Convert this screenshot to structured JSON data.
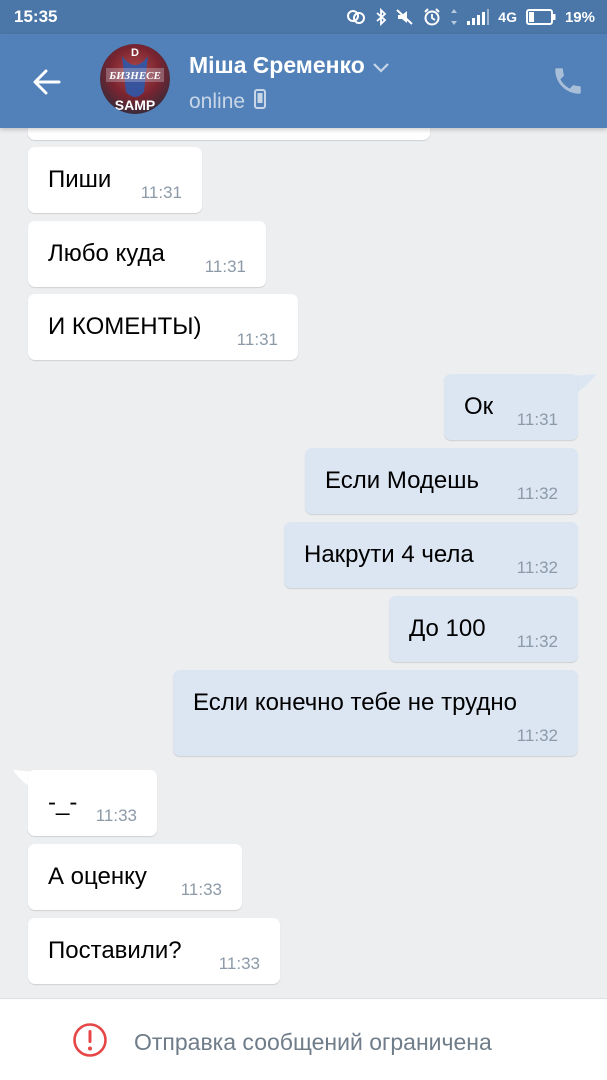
{
  "status_bar": {
    "time": "15:35",
    "network": "4G",
    "battery_percent": "19%",
    "icons": [
      "link-icon",
      "bluetooth-icon",
      "mute-icon",
      "alarm-icon",
      "data-arrows-icon",
      "signal-icon",
      "battery-icon"
    ]
  },
  "header": {
    "contact_name": "Міша Єременко",
    "status": "online",
    "avatar_text": {
      "top": "D",
      "middle": "БИЗНЕСЕ",
      "bottom": "SAMP"
    },
    "icons": [
      "back-arrow-icon",
      "chevron-down-icon",
      "mobile-phone-icon",
      "phone-call-icon"
    ]
  },
  "messages": [
    {
      "direction": "in",
      "text": "Пиши",
      "time": "11:31"
    },
    {
      "direction": "in",
      "text": "Любо куда",
      "time": "11:31"
    },
    {
      "direction": "in",
      "text": "И КОМЕНТЫ)",
      "time": "11:31"
    },
    {
      "direction": "out",
      "text": "Ок",
      "time": "11:31"
    },
    {
      "direction": "out",
      "text": "Если Модешь",
      "time": "11:32"
    },
    {
      "direction": "out",
      "text": "Накрути 4 чела",
      "time": "11:32"
    },
    {
      "direction": "out",
      "text": "До 100",
      "time": "11:32"
    },
    {
      "direction": "out",
      "text": "Если конечно тебе не трудно",
      "time": "11:32"
    },
    {
      "direction": "in",
      "text": "-_-",
      "time": "11:33"
    },
    {
      "direction": "in",
      "text": "А оценку",
      "time": "11:33"
    },
    {
      "direction": "in",
      "text": "Поставили?",
      "time": "11:33"
    }
  ],
  "footer": {
    "restriction_text": "Отправка сообщений ограничена",
    "icon": "alert-circle-icon"
  },
  "colors": {
    "status_bar": "#4a76a8",
    "header": "#5181b8",
    "chat_background": "#edeef0",
    "incoming_bubble": "#ffffff",
    "outgoing_bubble": "#dce6f3",
    "alert_red": "#e64646"
  }
}
